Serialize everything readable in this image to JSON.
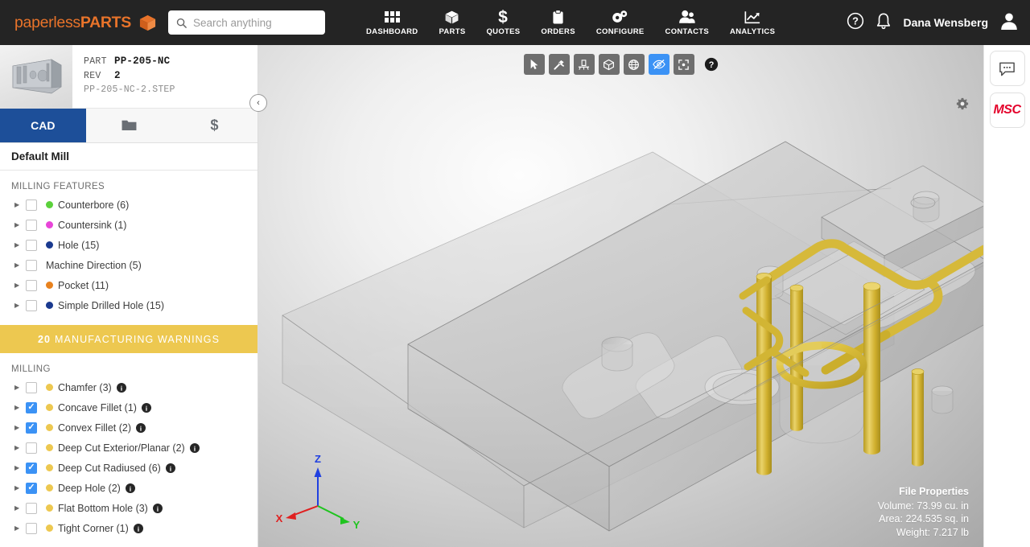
{
  "header": {
    "brand_light": "paperless",
    "brand_bold": "PARTS",
    "brand_cube_icon": "cube-icon",
    "search": {
      "placeholder": "Search anything",
      "value": "",
      "icon": "search-icon"
    },
    "nav": [
      {
        "label": "DASHBOARD",
        "icon": "grid-icon"
      },
      {
        "label": "PARTS",
        "icon": "cube-icon"
      },
      {
        "label": "QUOTES",
        "icon": "dollar-icon"
      },
      {
        "label": "ORDERS",
        "icon": "clipboard-icon"
      },
      {
        "label": "CONFIGURE",
        "icon": "gears-icon"
      },
      {
        "label": "CONTACTS",
        "icon": "people-icon"
      },
      {
        "label": "ANALYTICS",
        "icon": "chart-icon"
      }
    ],
    "help_icon": "help-circle-icon",
    "bell_icon": "bell-icon",
    "user_name": "Dana Wensberg",
    "avatar_icon": "user-avatar-icon"
  },
  "part": {
    "thumbnail_icon": "part-thumbnail",
    "part_key": "PART",
    "part_number": "PP-205-NC",
    "rev_key": "REV",
    "rev_value": "2",
    "filename": "PP-205-NC-2.STEP"
  },
  "tabs": [
    {
      "label": "CAD",
      "icon": "",
      "active": true
    },
    {
      "label": "",
      "icon": "folder-icon",
      "active": false
    },
    {
      "label": "",
      "icon": "dollar-icon",
      "active": false
    }
  ],
  "process_name": "Default Mill",
  "milling_features": {
    "section_label": "MILLING FEATURES",
    "items": [
      {
        "label": "Counterbore (6)",
        "color": "#5bd13b",
        "checked": false,
        "has_info": false
      },
      {
        "label": "Countersink (1)",
        "color": "#e845d8",
        "checked": false,
        "has_info": false
      },
      {
        "label": "Hole (15)",
        "color": "#1a3a8f",
        "checked": false,
        "has_info": false
      },
      {
        "label": "Machine Direction (5)",
        "color": "",
        "checked": false,
        "has_info": false
      },
      {
        "label": "Pocket (11)",
        "color": "#e8821e",
        "checked": false,
        "has_info": false
      },
      {
        "label": "Simple Drilled Hole (15)",
        "color": "#1a3a8f",
        "checked": false,
        "has_info": false
      }
    ]
  },
  "warnings_banner": {
    "count": "20",
    "text": "MANUFACTURING WARNINGS"
  },
  "milling": {
    "section_label": "MILLING",
    "items": [
      {
        "label": "Chamfer (3)",
        "color": "#edc850",
        "checked": false,
        "has_info": true
      },
      {
        "label": "Concave Fillet (1)",
        "color": "#edc850",
        "checked": true,
        "has_info": true
      },
      {
        "label": "Convex Fillet (2)",
        "color": "#edc850",
        "checked": true,
        "has_info": true
      },
      {
        "label": "Deep Cut Exterior/Planar (2)",
        "color": "#edc850",
        "checked": false,
        "has_info": true
      },
      {
        "label": "Deep Cut Radiused (6)",
        "color": "#edc850",
        "checked": true,
        "has_info": true
      },
      {
        "label": "Deep Hole (2)",
        "color": "#edc850",
        "checked": true,
        "has_info": true
      },
      {
        "label": "Flat Bottom Hole (3)",
        "color": "#edc850",
        "checked": false,
        "has_info": true
      },
      {
        "label": "Tight Corner (1)",
        "color": "#edc850",
        "checked": false,
        "has_info": true
      }
    ]
  },
  "collapse_button": {
    "glyph": "‹"
  },
  "viewer": {
    "toolbar": [
      {
        "name": "select-tool",
        "icon": "cursor-icon",
        "active": false
      },
      {
        "name": "measure-tool",
        "icon": "hammer-icon",
        "active": false
      },
      {
        "name": "section-tool",
        "icon": "section-plane-icon",
        "active": false
      },
      {
        "name": "box-view-tool",
        "icon": "box-icon",
        "active": false
      },
      {
        "name": "globe-tool",
        "icon": "globe-icon",
        "active": false
      },
      {
        "name": "hide-tool",
        "icon": "eye-slash-icon",
        "active": true
      },
      {
        "name": "fit-tool",
        "icon": "fit-screen-icon",
        "active": false
      }
    ],
    "help_icon": "help-circle-icon",
    "settings_icon": "gear-icon",
    "axes": {
      "x": "X",
      "y": "Y",
      "z": "Z",
      "x_color": "#e02020",
      "y_color": "#1fc41f",
      "z_color": "#2040e0"
    }
  },
  "file_properties": {
    "title": "File Properties",
    "volume": "Volume: 73.99 cu. in",
    "area": "Area: 224.535 sq. in",
    "weight": "Weight: 7.217 lb"
  },
  "right_rail": [
    {
      "name": "chat-button",
      "icon": "chat-bubble-icon",
      "text": ""
    },
    {
      "name": "msc-button",
      "icon": "msc-logo",
      "text": "MSC"
    }
  ]
}
